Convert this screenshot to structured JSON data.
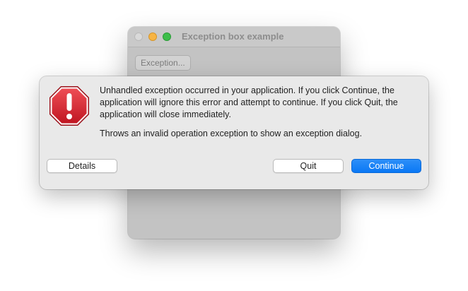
{
  "window": {
    "title": "Exception box example",
    "exception_button_label": "Exception..."
  },
  "alert": {
    "icon": "stop-sign-exclamation-icon",
    "message": "Unhandled exception occurred in your application. If you click Continue, the application will ignore this error and attempt to continue. If you click Quit, the application will close immediately.",
    "informative_text": "Throws an invalid operation exception to show an exception dialog.",
    "buttons": {
      "details": "Details",
      "quit": "Quit",
      "continue": "Continue"
    }
  },
  "colors": {
    "accent": "#0a78f5",
    "stop_red": "#d5202e",
    "minimize": "#f7b444",
    "zoom": "#3dbe4a"
  }
}
